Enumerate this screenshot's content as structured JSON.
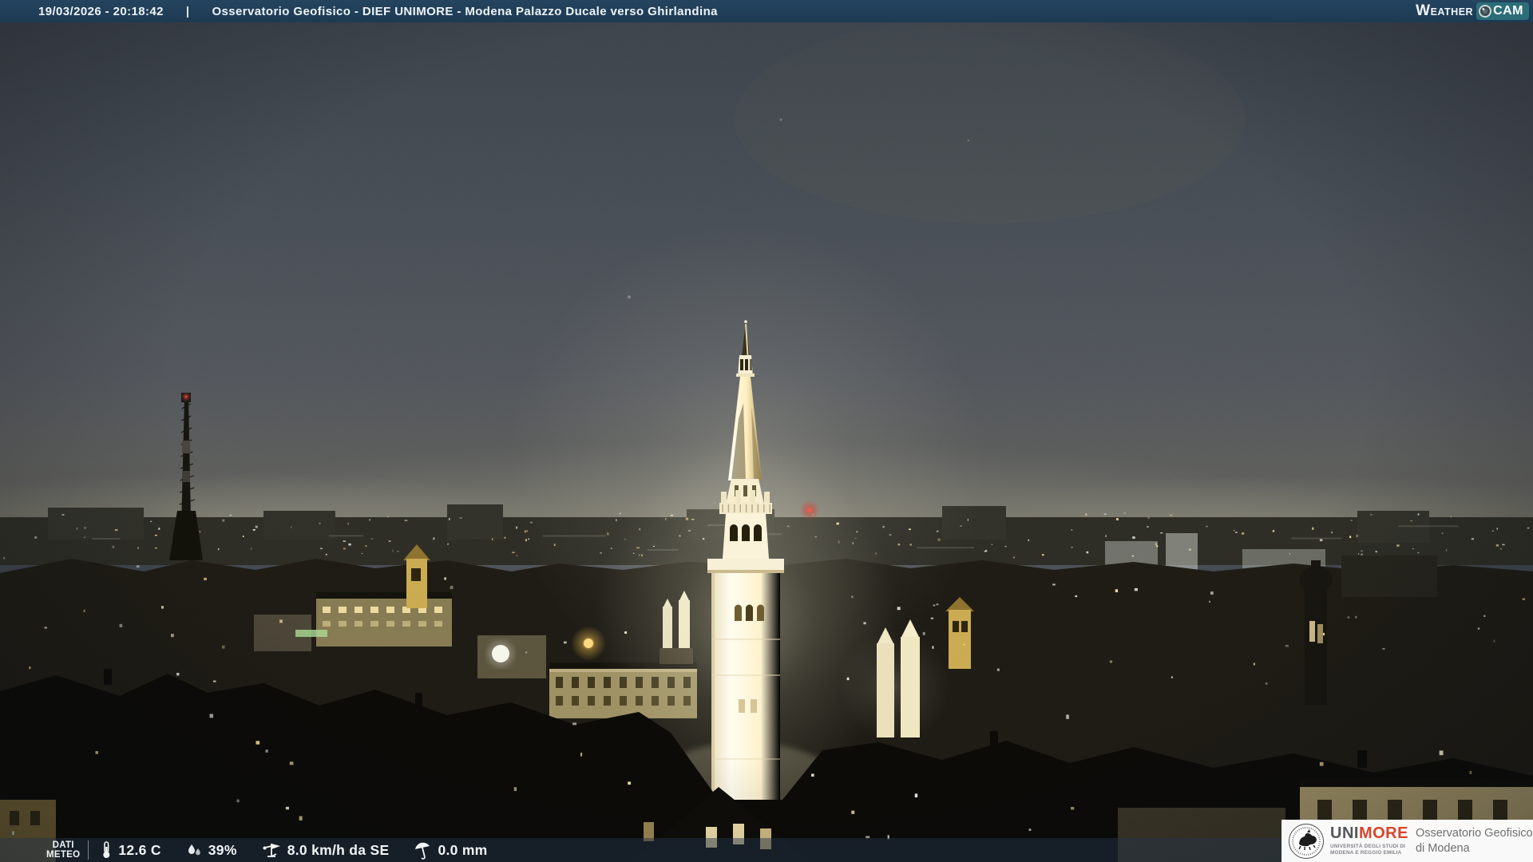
{
  "header": {
    "timestamp": "19/03/2026 - 20:18:42",
    "separator": "|",
    "title": "Osservatorio Geofisico - DIEF UNIMORE - Modena Palazzo Ducale verso Ghirlandina",
    "logo": {
      "weather": "WEATHER",
      "cam": "CAM"
    }
  },
  "footer": {
    "label_line1": "DATI",
    "label_line2": "METEO",
    "temperature": "12.6 C",
    "humidity": "39%",
    "wind": "8.0 km/h da SE",
    "rain": "0.0 mm"
  },
  "branding": {
    "uni": "UNI",
    "more": "MORE",
    "sub1": "UNIVERSITÀ DEGLI STUDI DI",
    "sub2": "MODENA E REGGIO EMILIA",
    "obs1": "Osservatorio Geofisico",
    "obs2": "di Modena"
  },
  "icons": {
    "temperature": "thermometer-icon",
    "humidity": "water-drops-icon",
    "wind": "wind-vane-icon",
    "rain": "umbrella-icon",
    "logo": "camera-lens-icon",
    "seal": "unimore-seal-icon"
  },
  "colors": {
    "top_bar": "#1d3a53",
    "cam_badge": "#2b6e79",
    "unimore_red": "#d9452c",
    "bar_text": "#f2f5f7",
    "sky_top": "#3e444b",
    "sky_horizon": "#67655a",
    "tower_light": "#fdf6dd"
  }
}
